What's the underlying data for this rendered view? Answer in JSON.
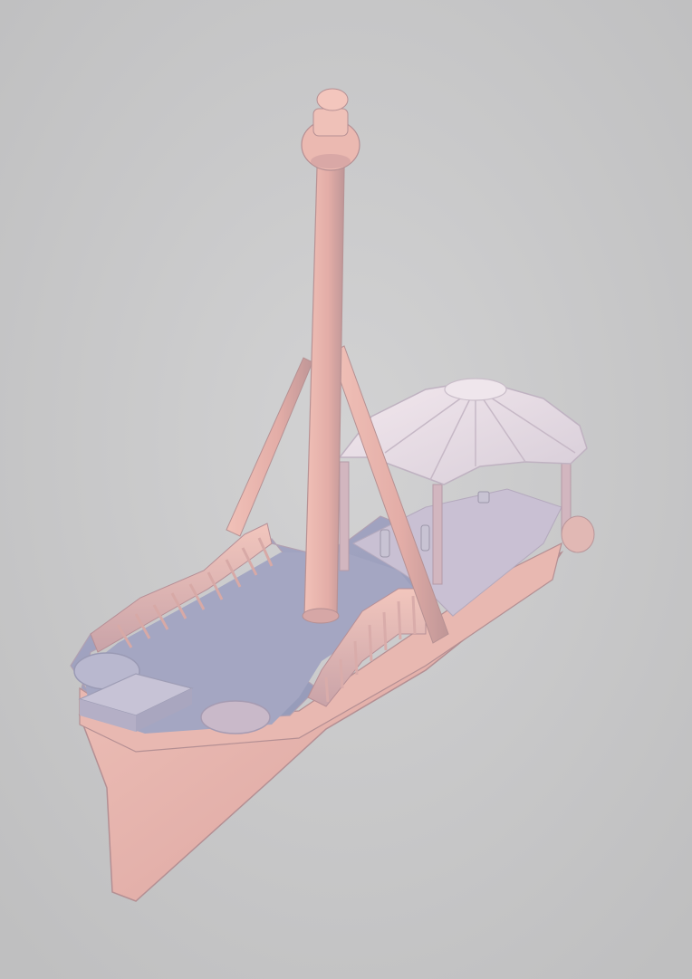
{
  "scene": {
    "subject": "3d-ship-model",
    "colors": {
      "background": "#c9c9c9",
      "hull": "#e8b8b0",
      "hull_shadow": "#c99f9e",
      "deck": "#9fa3bd",
      "dome": "#eadfe6",
      "mast": "#e6b3ad"
    }
  }
}
